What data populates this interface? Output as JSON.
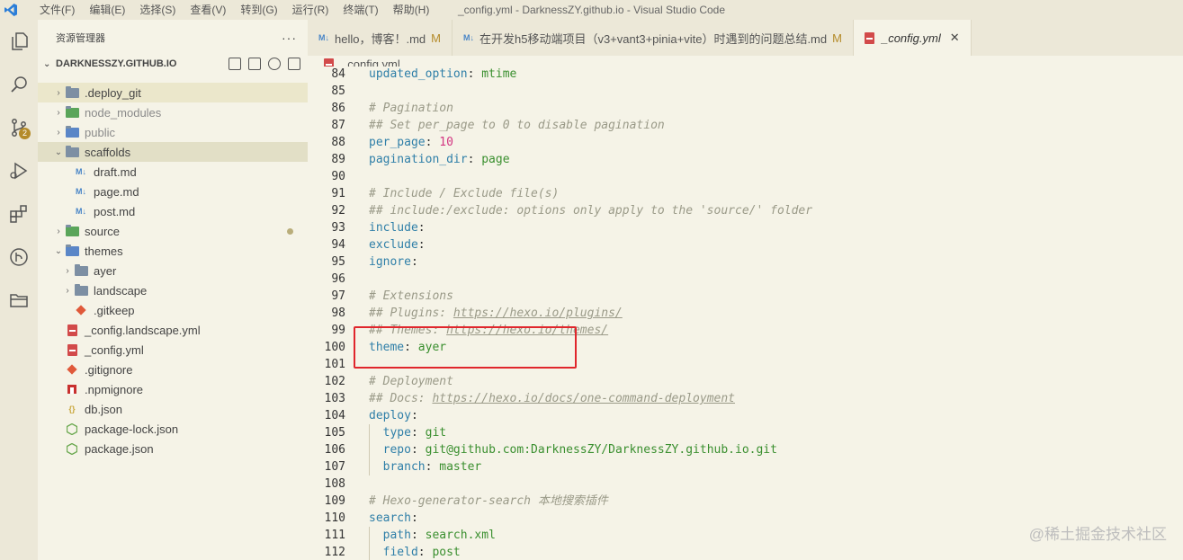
{
  "window": {
    "title": "_config.yml - DarknessZY.github.io - Visual Studio Code",
    "menu": [
      "文件(F)",
      "编辑(E)",
      "选择(S)",
      "查看(V)",
      "转到(G)",
      "运行(R)",
      "终端(T)",
      "帮助(H)"
    ]
  },
  "activity": {
    "scm_badge": "2"
  },
  "sidebar": {
    "title": "资源管理器",
    "more": "···",
    "project": "DARKNESSZY.GITHUB.IO",
    "items": [
      {
        "label": ".deploy_git"
      },
      {
        "label": "node_modules"
      },
      {
        "label": "public"
      },
      {
        "label": "scaffolds"
      },
      {
        "label": "draft.md"
      },
      {
        "label": "page.md"
      },
      {
        "label": "post.md"
      },
      {
        "label": "source"
      },
      {
        "label": "themes"
      },
      {
        "label": "ayer"
      },
      {
        "label": "landscape"
      },
      {
        "label": ".gitkeep"
      },
      {
        "label": "_config.landscape.yml"
      },
      {
        "label": "_config.yml"
      },
      {
        "label": ".gitignore"
      },
      {
        "label": ".npmignore"
      },
      {
        "label": "db.json"
      },
      {
        "label": "package-lock.json"
      },
      {
        "label": "package.json"
      }
    ]
  },
  "tabs": [
    {
      "label": "hello，博客！.md",
      "modified": "M"
    },
    {
      "label": "在开发h5移动端项目（v3+vant3+pinia+vite）时遇到的问题总结.md",
      "modified": "M"
    },
    {
      "label": "_config.yml",
      "close": "✕"
    }
  ],
  "breadcrumb": "_config.yml",
  "editor": {
    "lines": [
      {
        "n": "84",
        "k": "updated_option",
        "p": ": ",
        "v": "mtime"
      },
      {
        "n": "85"
      },
      {
        "n": "86",
        "c": "# Pagination"
      },
      {
        "n": "87",
        "c": "## Set per_page to 0 to disable pagination"
      },
      {
        "n": "88",
        "k": "per_page",
        "p": ": ",
        "num": "10"
      },
      {
        "n": "89",
        "k": "pagination_dir",
        "p": ": ",
        "v": "page"
      },
      {
        "n": "90"
      },
      {
        "n": "91",
        "c": "# Include / Exclude file(s)"
      },
      {
        "n": "92",
        "c": "## include:/exclude: options only apply to the 'source/' folder"
      },
      {
        "n": "93",
        "k": "include",
        "p": ":"
      },
      {
        "n": "94",
        "k": "exclude",
        "p": ":"
      },
      {
        "n": "95",
        "k": "ignore",
        "p": ":"
      },
      {
        "n": "96"
      },
      {
        "n": "97",
        "c": "# Extensions"
      },
      {
        "n": "98",
        "c": "## Plugins: ",
        "u": "https://hexo.io/plugins/"
      },
      {
        "n": "99",
        "c": "## Themes: ",
        "u": "https://hexo.io/themes/"
      },
      {
        "n": "100",
        "k": "theme",
        "p": ": ",
        "v": "ayer"
      },
      {
        "n": "101"
      },
      {
        "n": "102",
        "c": "# Deployment"
      },
      {
        "n": "103",
        "c": "## Docs: ",
        "u": "https://hexo.io/docs/one-command-deployment"
      },
      {
        "n": "104",
        "k": "deploy",
        "p": ":"
      },
      {
        "n": "105",
        "ind": "  ",
        "k": "type",
        "p": ": ",
        "v": "git"
      },
      {
        "n": "106",
        "ind": "  ",
        "k": "repo",
        "p": ": ",
        "v": "git@github.com:DarknessZY/DarknessZY.github.io.git"
      },
      {
        "n": "107",
        "ind": "  ",
        "k": "branch",
        "p": ": ",
        "v": "master"
      },
      {
        "n": "108"
      },
      {
        "n": "109",
        "c": "# Hexo-generator-search 本地搜索插件"
      },
      {
        "n": "110",
        "k": "search",
        "p": ":"
      },
      {
        "n": "111",
        "ind": "  ",
        "k": "path",
        "p": ": ",
        "v": "search.xml"
      },
      {
        "n": "112",
        "ind": "  ",
        "k": "field",
        "p": ": ",
        "v": "post"
      }
    ]
  },
  "watermark": "@稀土掘金技术社区",
  "colors": {
    "accent": "#b48b2a",
    "highlight_box": "#e0262c"
  }
}
